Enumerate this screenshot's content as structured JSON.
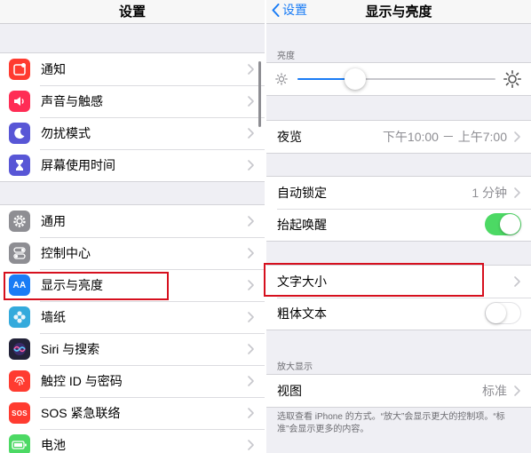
{
  "left": {
    "title": "设置",
    "groups": [
      [
        {
          "label": "通知",
          "icon": "notifications-icon",
          "color": "#ff3b30"
        },
        {
          "label": "声音与触感",
          "icon": "speaker-icon",
          "color": "#ff2d55"
        },
        {
          "label": "勿扰模式",
          "icon": "moon-icon",
          "color": "#5856d6"
        },
        {
          "label": "屏幕使用时间",
          "icon": "hourglass-icon",
          "color": "#5856d6"
        }
      ],
      [
        {
          "label": "通用",
          "icon": "gear-icon",
          "color": "#8e8e93"
        },
        {
          "label": "控制中心",
          "icon": "toggles-icon",
          "color": "#8e8e93"
        },
        {
          "label": "显示与亮度",
          "icon": "text-size-icon",
          "color": "#1a7cf5",
          "icon_text": "AA"
        },
        {
          "label": "墙纸",
          "icon": "flower-icon",
          "color": "#34aadc"
        },
        {
          "label": "Siri 与搜索",
          "icon": "siri-icon",
          "color": "#222238"
        },
        {
          "label": "触控 ID 与密码",
          "icon": "fingerprint-icon",
          "color": "#ff3b30"
        },
        {
          "label": "SOS 紧急联络",
          "icon": "sos-icon",
          "color": "#ff3b30",
          "icon_text": "SOS"
        },
        {
          "label": "电池",
          "icon": "battery-icon",
          "color": "#4cd964"
        }
      ]
    ]
  },
  "right": {
    "back_label": "设置",
    "title": "显示与亮度",
    "brightness": {
      "header": "亮度",
      "level": 0.29
    },
    "night_shift": {
      "label": "夜览",
      "value": "下午10:00 － 上午7:00"
    },
    "auto_lock": {
      "label": "自动锁定",
      "value": "1 分钟"
    },
    "raise_to_wake": {
      "label": "抬起唤醒",
      "on": true
    },
    "text_size": {
      "label": "文字大小"
    },
    "bold_text": {
      "label": "粗体文本",
      "on": false
    },
    "zoom": {
      "header": "放大显示",
      "view_label": "视图",
      "view_value": "标准",
      "footer": "选取查看 iPhone 的方式。“放大”会显示更大的控制项。“标准”会显示更多的内容。"
    }
  },
  "colors": {
    "accent": "#1a7cf5",
    "toggle_on": "#4cd964",
    "highlight": "#d6101e"
  }
}
